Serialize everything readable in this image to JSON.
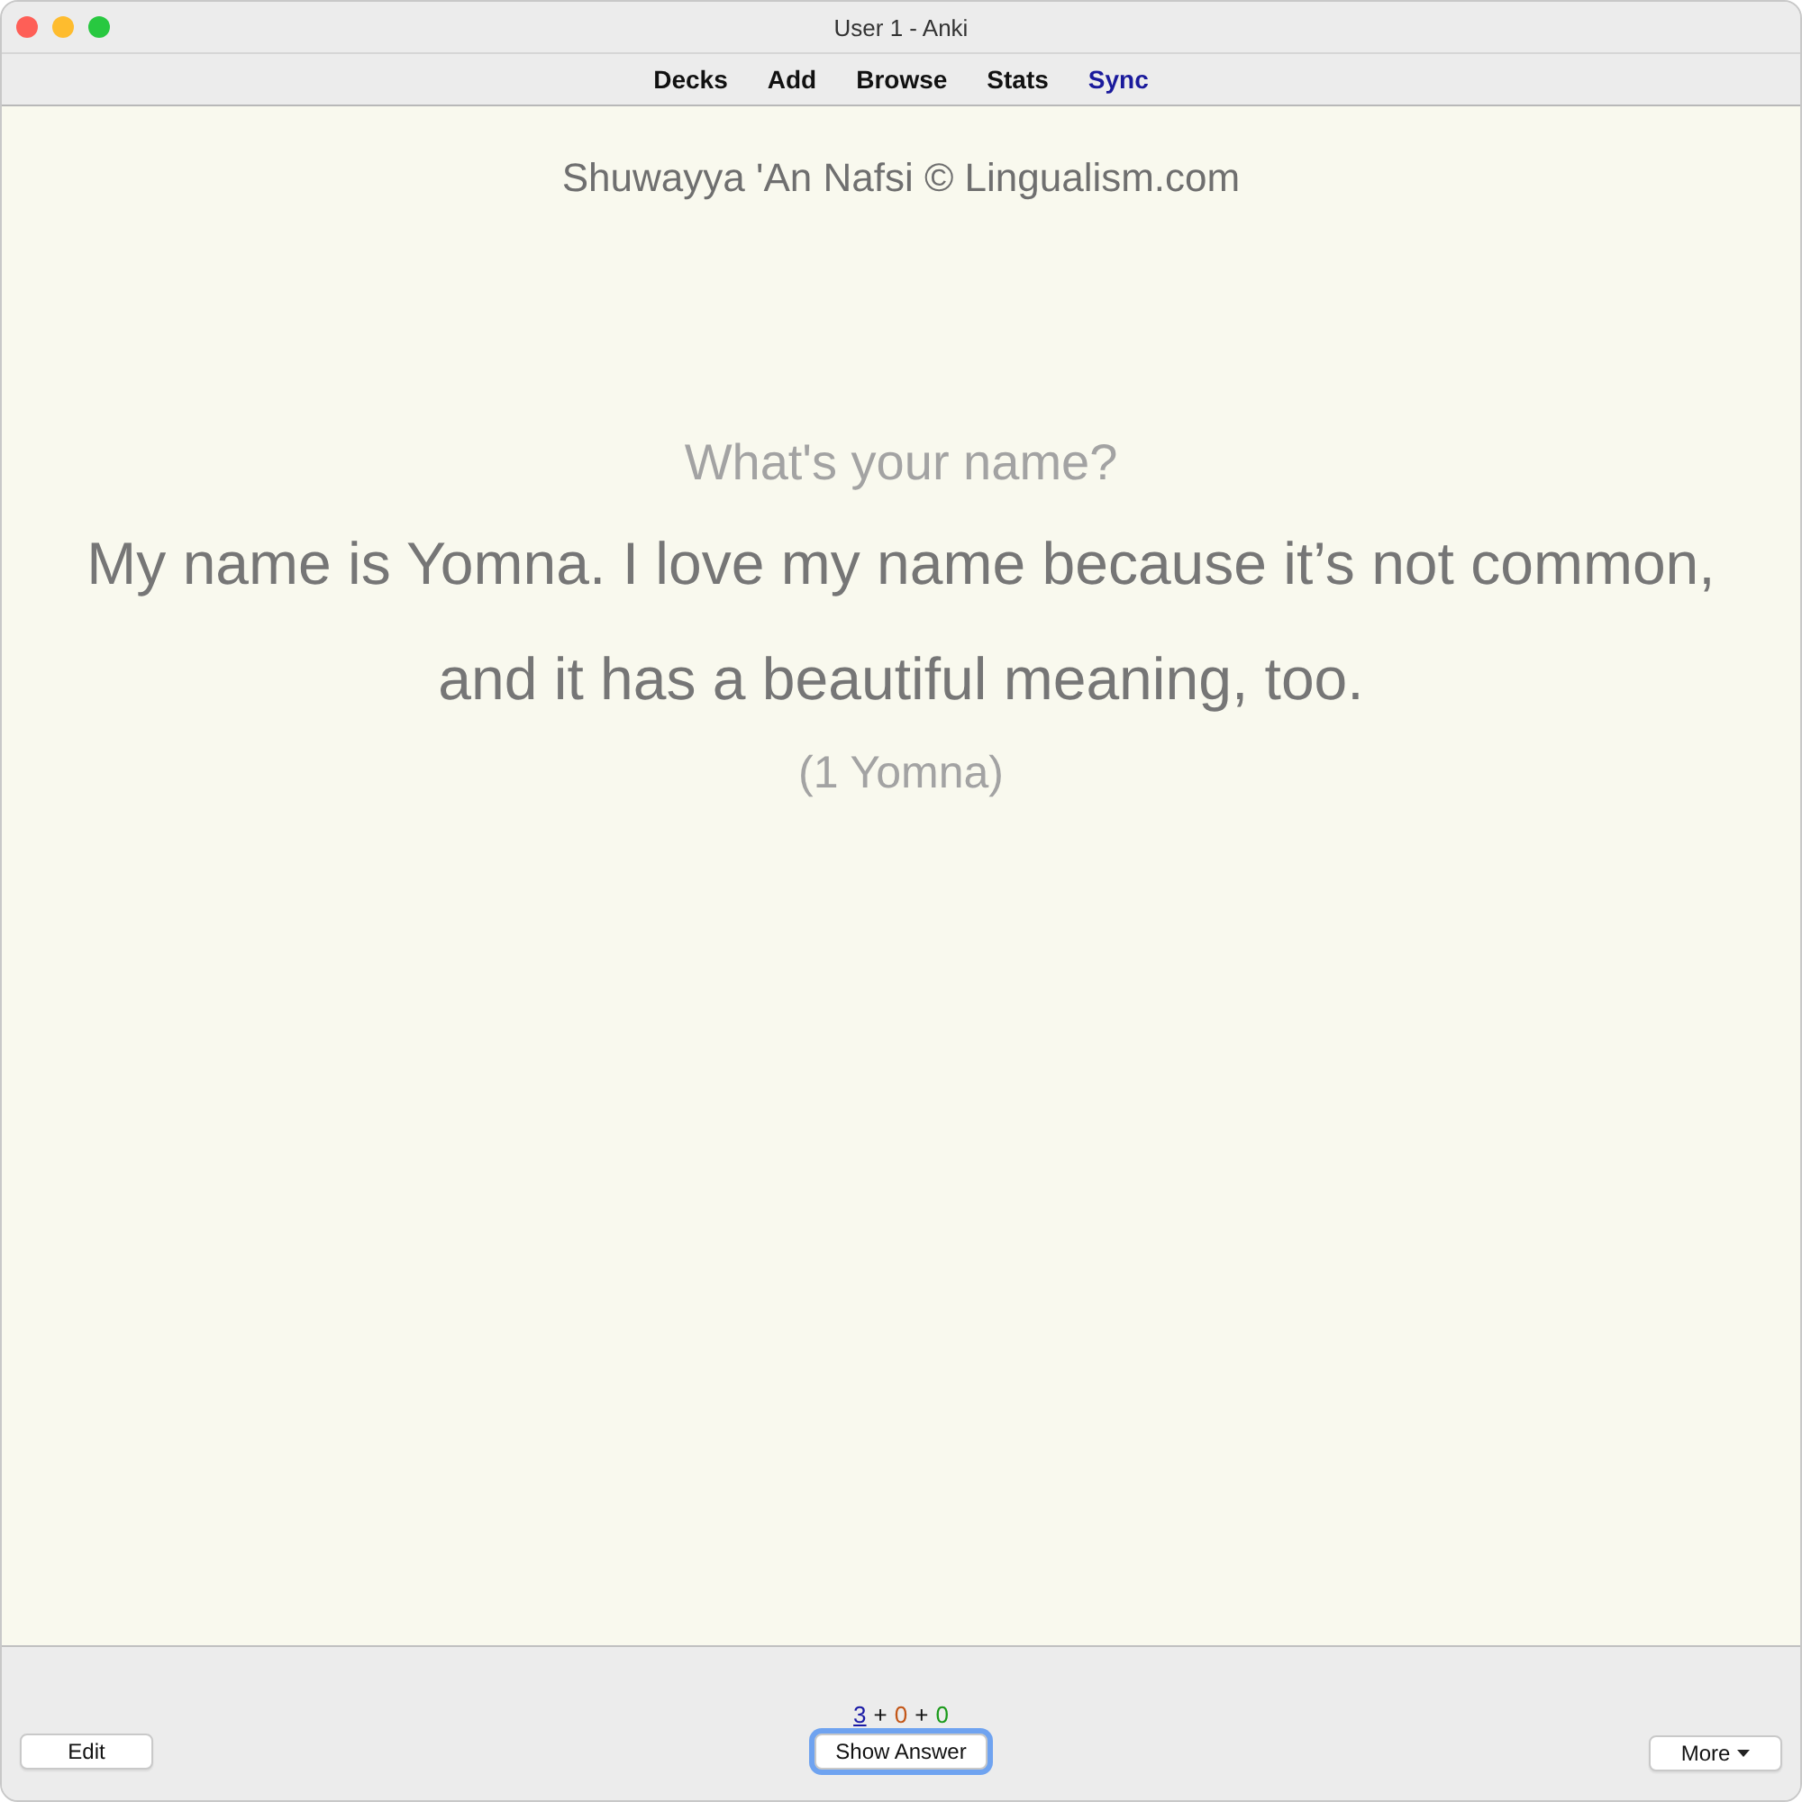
{
  "window": {
    "title": "User 1 - Anki"
  },
  "toolbar": {
    "links": [
      {
        "label": "Decks",
        "highlighted": false
      },
      {
        "label": "Add",
        "highlighted": false
      },
      {
        "label": "Browse",
        "highlighted": false
      },
      {
        "label": "Stats",
        "highlighted": false
      },
      {
        "label": "Sync",
        "highlighted": true
      }
    ]
  },
  "card": {
    "deck_title": "Shuwayya 'An Nafsi © Lingualism.com",
    "question": "What's your name?",
    "answer_lines": [
      "My name is Yomna. I love my name because it’s not common,",
      "and it has a beautiful meaning, too."
    ],
    "note": "(1 Yomna)"
  },
  "bottom_bar": {
    "counts": [
      {
        "kind": "count",
        "text": "3",
        "color": "#1a1aa6",
        "selected": true
      },
      {
        "kind": "separator",
        "text": "+"
      },
      {
        "kind": "count",
        "text": "0",
        "color": "#c35617",
        "selected": false
      },
      {
        "kind": "separator",
        "text": "+"
      },
      {
        "kind": "count",
        "text": "0",
        "color": "#1a9a1a",
        "selected": false
      }
    ],
    "edit_button": "Edit",
    "answer_button": {
      "label": "Show Answer",
      "focused": true
    },
    "more_button": "More"
  }
}
